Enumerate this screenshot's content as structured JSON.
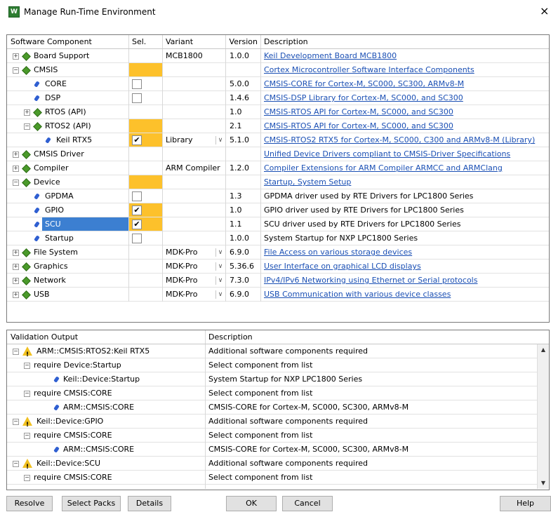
{
  "window": {
    "title": "Manage Run-Time Environment",
    "close": "×"
  },
  "components": {
    "headers": {
      "name": "Software Component",
      "sel": "Sel.",
      "variant": "Variant",
      "version": "Version",
      "description": "Description"
    },
    "rows": [
      {
        "name": "Board Support",
        "level": 0,
        "icon": "package-icon",
        "expander": "+",
        "sel": "",
        "variant": "MCB1800",
        "version": "1.0.0",
        "description": "Keil Development Board MCB1800",
        "link": true
      },
      {
        "name": "CMSIS",
        "level": 0,
        "icon": "package-icon",
        "expander": "-",
        "sel": "yellow",
        "variant": "",
        "version": "",
        "description": "Cortex Microcontroller Software Interface Components",
        "link": true
      },
      {
        "name": "CORE",
        "level": 1,
        "icon": "component-icon",
        "expander": "",
        "sel": "box",
        "variant": "",
        "version": "5.0.0",
        "description": "CMSIS-CORE for Cortex-M, SC000, SC300, ARMv8-M",
        "link": true
      },
      {
        "name": "DSP",
        "level": 1,
        "icon": "component-icon",
        "expander": "",
        "sel": "box",
        "variant": "",
        "version": "1.4.6",
        "description": "CMSIS-DSP Library for Cortex-M, SC000, and SC300",
        "link": true
      },
      {
        "name": "RTOS (API)",
        "level": 1,
        "icon": "package-icon",
        "expander": "+",
        "sel": "",
        "variant": "",
        "version": "1.0",
        "description": "CMSIS-RTOS API for Cortex-M, SC000, and SC300",
        "link": true
      },
      {
        "name": "RTOS2 (API)",
        "level": 1,
        "icon": "package-icon",
        "expander": "-",
        "sel": "yellow",
        "variant": "",
        "version": "2.1",
        "description": "CMSIS-RTOS API for Cortex-M, SC000, and SC300",
        "link": true
      },
      {
        "name": "Keil RTX5",
        "level": 2,
        "icon": "component-icon",
        "expander": "",
        "sel": "checked",
        "variant": "Library",
        "dropdown": true,
        "version": "5.1.0",
        "description": "CMSIS-RTOS2 RTX5 for Cortex-M, SC000, C300 and ARMv8-M (Library)",
        "link": true
      },
      {
        "name": "CMSIS Driver",
        "level": 0,
        "icon": "package-icon",
        "expander": "+",
        "sel": "",
        "variant": "",
        "version": "",
        "description": "Unified Device Drivers compliant to CMSIS-Driver Specifications",
        "link": true
      },
      {
        "name": "Compiler",
        "level": 0,
        "icon": "package-icon",
        "expander": "+",
        "sel": "",
        "variant": "ARM Compiler",
        "version": "1.2.0",
        "description": "Compiler Extensions for ARM Compiler ARMCC and ARMClang",
        "link": true
      },
      {
        "name": "Device",
        "level": 0,
        "icon": "package-icon",
        "expander": "-",
        "sel": "yellow",
        "variant": "",
        "version": "",
        "description": "Startup, System Setup",
        "link": true
      },
      {
        "name": "GPDMA",
        "level": 1,
        "icon": "component-icon",
        "expander": "",
        "sel": "box",
        "variant": "",
        "version": "1.3",
        "description": "GPDMA driver used by RTE Drivers for LPC1800 Series",
        "link": false
      },
      {
        "name": "GPIO",
        "level": 1,
        "icon": "component-icon",
        "expander": "",
        "sel": "checked",
        "variant": "",
        "version": "1.0",
        "description": "GPIO driver used by RTE Drivers for LPC1800 Series",
        "link": false
      },
      {
        "name": "SCU",
        "level": 1,
        "icon": "component-icon",
        "expander": "",
        "sel": "checked",
        "variant": "",
        "version": "1.1",
        "description": "SCU driver used by RTE Drivers for LPC1800 Series",
        "link": false,
        "selected": true
      },
      {
        "name": "Startup",
        "level": 1,
        "icon": "component-icon",
        "expander": "",
        "sel": "box",
        "variant": "",
        "version": "1.0.0",
        "description": "System Startup for NXP LPC1800 Series",
        "link": false
      },
      {
        "name": "File System",
        "level": 0,
        "icon": "package-icon",
        "expander": "+",
        "sel": "",
        "variant": "MDK-Pro",
        "dropdown": true,
        "version": "6.9.0",
        "description": "File Access on various storage devices",
        "link": true
      },
      {
        "name": "Graphics",
        "level": 0,
        "icon": "package-icon",
        "expander": "+",
        "sel": "",
        "variant": "MDK-Pro",
        "dropdown": true,
        "version": "5.36.6",
        "description": "User Interface on graphical LCD displays",
        "link": true
      },
      {
        "name": "Network",
        "level": 0,
        "icon": "package-icon",
        "expander": "+",
        "sel": "",
        "variant": "MDK-Pro",
        "dropdown": true,
        "version": "7.3.0",
        "description": "IPv4/IPv6 Networking using Ethernet or Serial protocols",
        "link": true
      },
      {
        "name": "USB",
        "level": 0,
        "icon": "package-icon",
        "expander": "+",
        "sel": "",
        "variant": "MDK-Pro",
        "dropdown": true,
        "version": "6.9.0",
        "description": "USB Communication with various device classes",
        "link": true
      }
    ]
  },
  "validation": {
    "headers": {
      "output": "Validation Output",
      "description": "Description"
    },
    "rows": [
      {
        "text": "ARM::CMSIS:RTOS2:Keil RTX5",
        "level": 0,
        "icon": "warning-icon",
        "expander": "-",
        "description": "Additional software components required"
      },
      {
        "text": "require Device:Startup",
        "level": 1,
        "icon": "",
        "expander": "-",
        "description": "Select component from list"
      },
      {
        "text": "Keil::Device:Startup",
        "level": 2,
        "icon": "component-icon",
        "expander": "",
        "description": "System Startup for NXP LPC1800 Series"
      },
      {
        "text": "require CMSIS:CORE",
        "level": 1,
        "icon": "",
        "expander": "-",
        "description": "Select component from list"
      },
      {
        "text": "ARM::CMSIS:CORE",
        "level": 2,
        "icon": "component-icon",
        "expander": "",
        "description": "CMSIS-CORE for Cortex-M, SC000, SC300, ARMv8-M"
      },
      {
        "text": "Keil::Device:GPIO",
        "level": 0,
        "icon": "warning-icon",
        "expander": "-",
        "description": "Additional software components required"
      },
      {
        "text": "require CMSIS:CORE",
        "level": 1,
        "icon": "",
        "expander": "-",
        "description": "Select component from list"
      },
      {
        "text": "ARM::CMSIS:CORE",
        "level": 2,
        "icon": "component-icon",
        "expander": "",
        "description": "CMSIS-CORE for Cortex-M, SC000, SC300, ARMv8-M"
      },
      {
        "text": "Keil::Device:SCU",
        "level": 0,
        "icon": "warning-icon",
        "expander": "-",
        "description": "Additional software components required"
      },
      {
        "text": "require CMSIS:CORE",
        "level": 1,
        "icon": "",
        "expander": "-",
        "description": "Select component from list"
      }
    ]
  },
  "buttons": {
    "resolve": "Resolve",
    "select_packs": "Select Packs",
    "details": "Details",
    "ok": "OK",
    "cancel": "Cancel",
    "help": "Help"
  },
  "colors": {
    "yellow": "#fdc12b",
    "link": "#1a4fb4",
    "selection": "#3c7fd1"
  }
}
